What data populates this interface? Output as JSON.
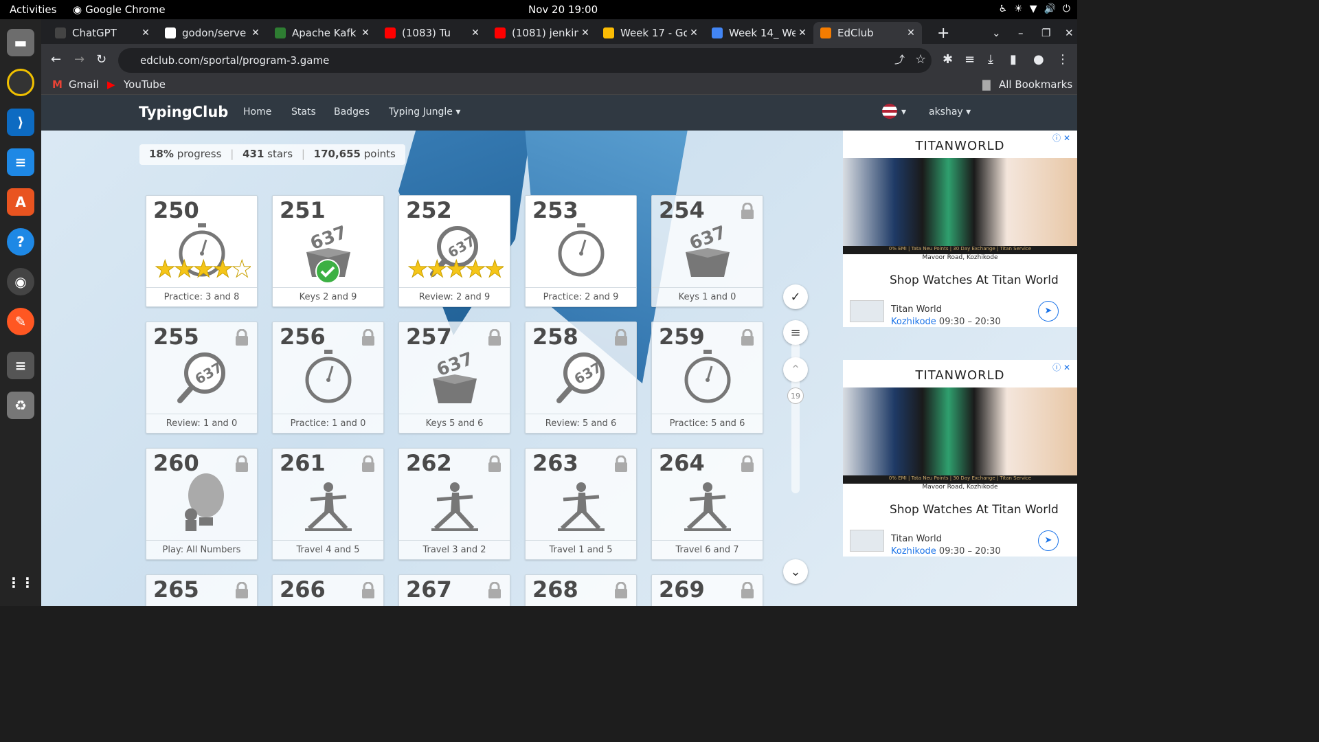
{
  "os": {
    "activities": "Activities",
    "app_name": "Google Chrome",
    "clock": "Nov 20  19:00"
  },
  "tabs": [
    {
      "title": "ChatGPT",
      "fav": "#444"
    },
    {
      "title": "godon/serve",
      "fav": "#fff"
    },
    {
      "title": "Apache Kafk",
      "fav": "#2e7d32"
    },
    {
      "title": "(1083) Tu",
      "fav": "#ff0000"
    },
    {
      "title": "(1081) jenkin",
      "fav": "#ff0000"
    },
    {
      "title": "Week 17 - Go",
      "fav": "#fbbc04"
    },
    {
      "title": "Week 14_ We",
      "fav": "#4285f4"
    },
    {
      "title": "EdClub",
      "fav": "#f57c00"
    }
  ],
  "url": "edclub.com/sportal/program-3.game",
  "bookmarks": {
    "gmail": "Gmail",
    "youtube": "YouTube",
    "all": "All Bookmarks"
  },
  "site_nav": {
    "brand": "TypingClub",
    "home": "Home",
    "stats": "Stats",
    "badges": "Badges",
    "jungle": "Typing Jungle ▾",
    "user": "akshay ▾"
  },
  "progress": {
    "percent": "18%",
    "percent_label": "progress",
    "stars": "431",
    "stars_label": "stars",
    "points": "170,655",
    "points_label": "points"
  },
  "lessons": [
    {
      "num": "250",
      "label": "Practice: 3 and 8",
      "kind": "timer",
      "locked": false,
      "stars": 4.5
    },
    {
      "num": "251",
      "label": "Keys 2 and 9",
      "kind": "box",
      "locked": false,
      "check": true
    },
    {
      "num": "252",
      "label": "Review: 2 and 9",
      "kind": "mag",
      "locked": false,
      "stars": 5
    },
    {
      "num": "253",
      "label": "Practice: 2 and 9",
      "kind": "timer",
      "locked": false
    },
    {
      "num": "254",
      "label": "Keys 1 and 0",
      "kind": "box",
      "locked": true
    },
    {
      "num": "255",
      "label": "Review: 1 and 0",
      "kind": "mag",
      "locked": true
    },
    {
      "num": "256",
      "label": "Practice: 1 and 0",
      "kind": "timer",
      "locked": true
    },
    {
      "num": "257",
      "label": "Keys 5 and 6",
      "kind": "box",
      "locked": true
    },
    {
      "num": "258",
      "label": "Review: 5 and 6",
      "kind": "mag",
      "locked": true
    },
    {
      "num": "259",
      "label": "Practice: 5 and 6",
      "kind": "timer",
      "locked": true
    },
    {
      "num": "260",
      "label": "Play: All Numbers",
      "kind": "balloon",
      "locked": true
    },
    {
      "num": "261",
      "label": "Travel 4 and 5",
      "kind": "pose",
      "locked": true
    },
    {
      "num": "262",
      "label": "Travel 3 and 2",
      "kind": "pose",
      "locked": true
    },
    {
      "num": "263",
      "label": "Travel 1 and 5",
      "kind": "pose",
      "locked": true
    },
    {
      "num": "264",
      "label": "Travel 6 and 7",
      "kind": "pose",
      "locked": true
    },
    {
      "num": "265",
      "label": "",
      "kind": "pose",
      "locked": true
    },
    {
      "num": "266",
      "label": "",
      "kind": "pose",
      "locked": true
    },
    {
      "num": "267",
      "label": "",
      "kind": "keyboard",
      "locked": true
    },
    {
      "num": "268",
      "label": "",
      "kind": "keyboard",
      "locked": true
    },
    {
      "num": "269",
      "label": "",
      "kind": "pose",
      "locked": true
    }
  ],
  "level_indicator": "19",
  "ads": [
    {
      "brand": "TITANWORLD",
      "strip": "0% EMI | Tata Neu Points | 30 Day Exchange | Titan Service",
      "address": "Mavoor Road, Kozhikode",
      "headline": "Shop Watches At Titan World",
      "shop": "Titan World",
      "city": "Kozhikode",
      "hours": "09:30 – 20:30"
    },
    {
      "brand": "TITANWORLD",
      "strip": "0% EMI | Tata Neu Points | 30 Day Exchange | Titan Service",
      "address": "Mavoor Road, Kozhikode",
      "headline": "Shop Watches At Titan World",
      "shop": "Titan World",
      "city": "Kozhikode",
      "hours": "09:30 – 20:30"
    }
  ],
  "colors": {
    "navbar": "#303942",
    "star": "#f5c518",
    "check": "#3cb043"
  }
}
